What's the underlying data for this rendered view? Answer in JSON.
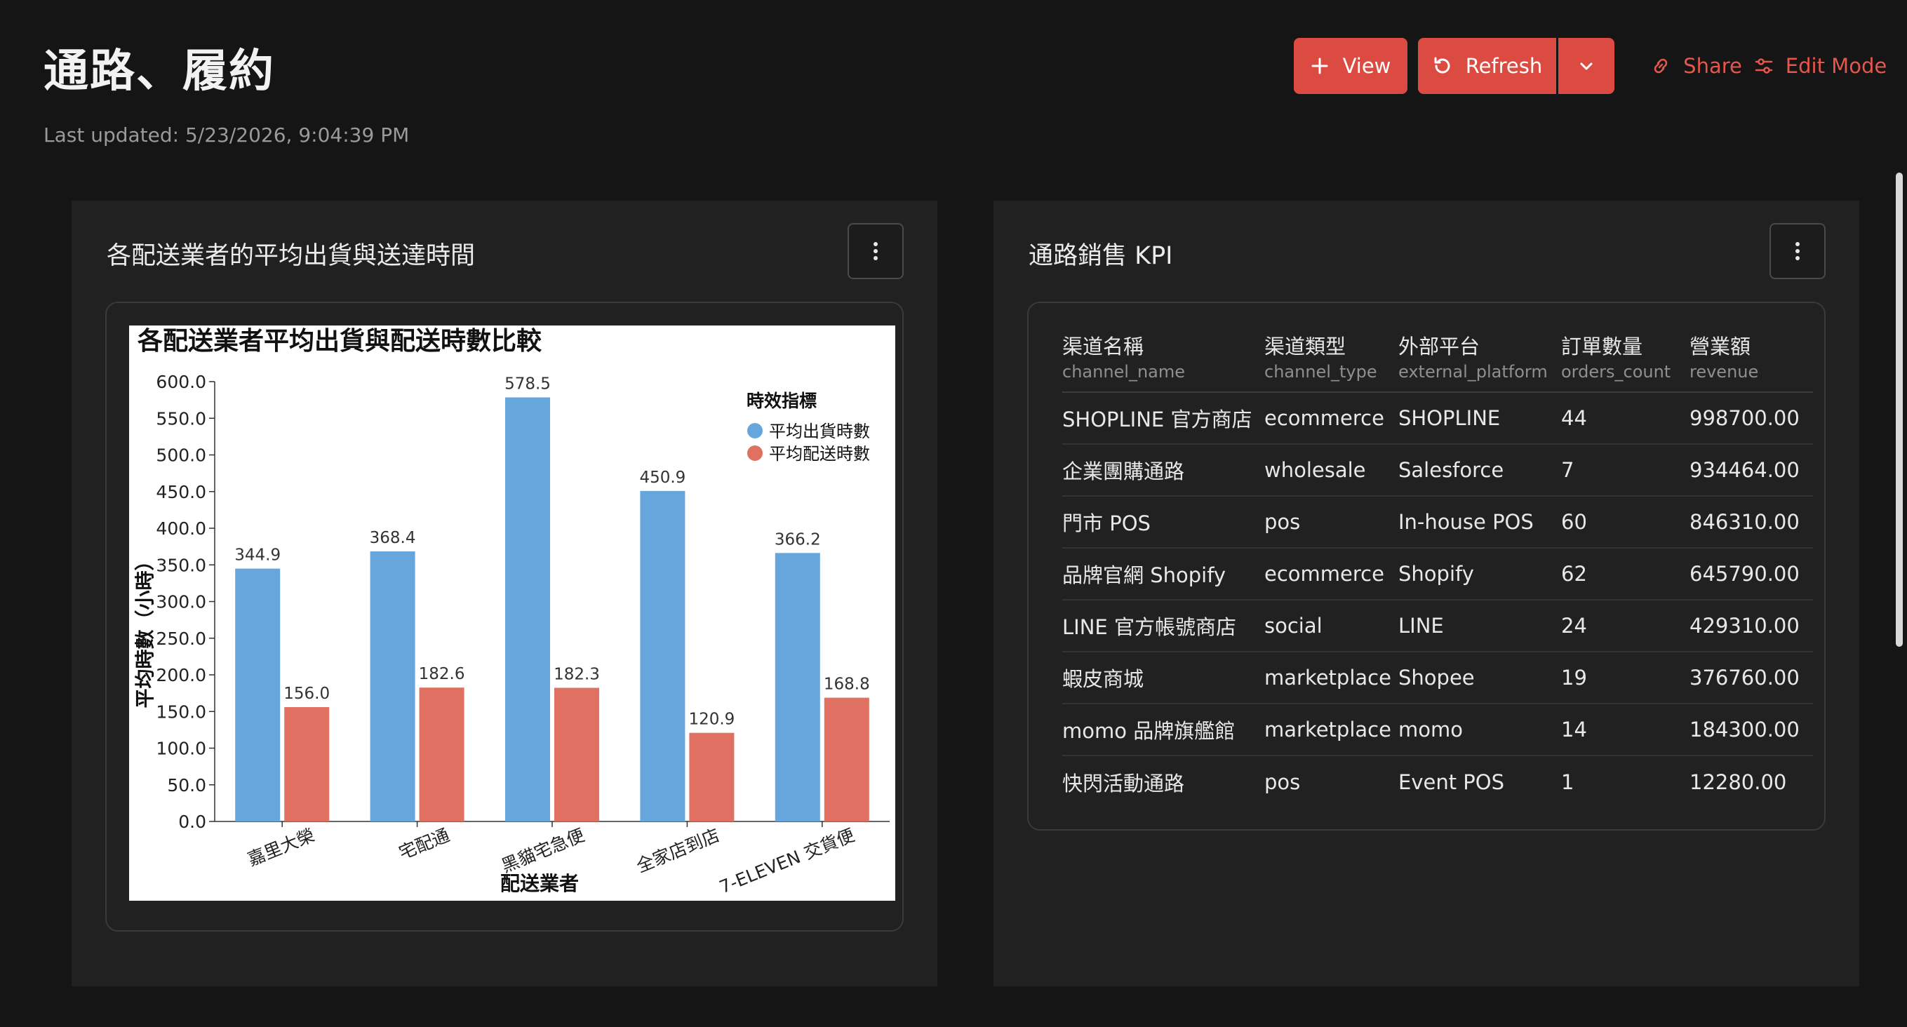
{
  "header": {
    "title": "通路、履約",
    "last_updated": "Last updated: 5/23/2026, 9:04:39 PM"
  },
  "toolbar": {
    "view_label": "View",
    "refresh_label": "Refresh",
    "share_label": "Share",
    "edit_label": "Edit Mode",
    "accent_color": "#dc4b41"
  },
  "cards": {
    "left": {
      "title": "各配送業者的平均出貨與送達時間"
    },
    "right": {
      "title": "通路銷售 KPI"
    }
  },
  "chart_data": {
    "type": "bar",
    "title": "各配送業者平均出貨與配送時數比較",
    "xlabel": "配送業者",
    "ylabel": "平均時數（小時）",
    "categories": [
      "嘉里大榮",
      "宅配通",
      "黑貓宅急便",
      "全家店到店",
      "7-ELEVEN 交貨便"
    ],
    "series": [
      {
        "name": "平均出貨時數",
        "values": [
          344.9,
          368.4,
          578.5,
          450.9,
          366.2
        ],
        "color": "#66a6dc"
      },
      {
        "name": "平均配送時數",
        "values": [
          156.0,
          182.6,
          182.3,
          120.9,
          168.8
        ],
        "color": "#e07061"
      }
    ],
    "data_labels": {
      "series0": [
        "344.9",
        "368.4",
        "578.5",
        "450.9",
        "366.2"
      ],
      "series1": [
        "156.0",
        "182.6",
        "182.3",
        "120.9",
        "168.8"
      ]
    },
    "yticks": [
      "0.0",
      "50.0",
      "100.0",
      "150.0",
      "200.0",
      "250.0",
      "300.0",
      "350.0",
      "400.0",
      "450.0",
      "500.0",
      "550.0",
      "600.0"
    ],
    "ylim": [
      0,
      600
    ],
    "legend_title": "時效指標",
    "legend_position": "top-right",
    "grid": false
  },
  "kpi_table": {
    "columns": [
      {
        "label": "渠道名稱",
        "key": "channel_name"
      },
      {
        "label": "渠道類型",
        "key": "channel_type"
      },
      {
        "label": "外部平台",
        "key": "external_platform"
      },
      {
        "label": "訂單數量",
        "key": "orders_count"
      },
      {
        "label": "營業額",
        "key": "revenue"
      }
    ],
    "rows": [
      [
        "SHOPLINE 官方商店",
        "ecommerce",
        "SHOPLINE",
        "44",
        "998700.00"
      ],
      [
        "企業團購通路",
        "wholesale",
        "Salesforce",
        "7",
        "934464.00"
      ],
      [
        "門市 POS",
        "pos",
        "In-house POS",
        "60",
        "846310.00"
      ],
      [
        "品牌官網 Shopify",
        "ecommerce",
        "Shopify",
        "62",
        "645790.00"
      ],
      [
        "LINE 官方帳號商店",
        "social",
        "LINE",
        "24",
        "429310.00"
      ],
      [
        "蝦皮商城",
        "marketplace",
        "Shopee",
        "19",
        "376760.00"
      ],
      [
        "momo 品牌旗艦館",
        "marketplace",
        "momo",
        "14",
        "184300.00"
      ],
      [
        "快閃活動通路",
        "pos",
        "Event POS",
        "1",
        "12280.00"
      ]
    ]
  }
}
